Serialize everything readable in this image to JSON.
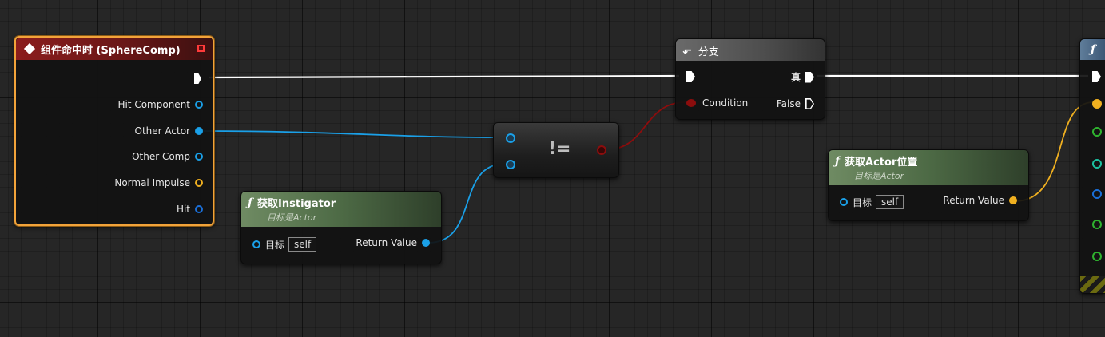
{
  "event_node": {
    "title": "组件命中时 (SphereComp)",
    "pins": [
      "Hit Component",
      "Other Actor",
      "Other Comp",
      "Normal Impulse",
      "Hit"
    ]
  },
  "instigator_node": {
    "title": "获取Instigator",
    "subtitle": "目标是Actor",
    "target_label": "目标",
    "target_value": "self",
    "return_label": "Return Value"
  },
  "not_equal_node": {
    "symbol": "!="
  },
  "branch_node": {
    "title": "分支",
    "condition_label": "Condition",
    "true_label": "真",
    "false_label": "False"
  },
  "location_node": {
    "title": "获取Actor位置",
    "subtitle": "目标是Actor",
    "target_label": "目标",
    "target_value": "self",
    "return_label": "Return Value"
  },
  "partial_node": {
    "icon_glyph": "ƒ"
  },
  "colors": {
    "exec": "#ffffff",
    "object": "#1aa0e8",
    "struct": "#f0b020",
    "boolean": "#8c0d0d",
    "vector_green": "#2fb32f",
    "teal": "#1cc0a0",
    "selection": "#f2a33a"
  }
}
